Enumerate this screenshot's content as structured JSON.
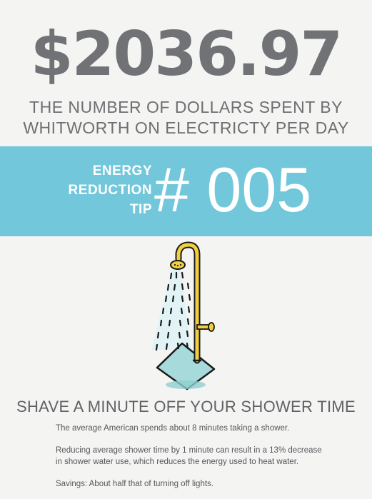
{
  "headline": {
    "amount": "$2036.97",
    "line1": "THE NUMBER OF DOLLARS SPENT BY",
    "line2": "WHITWORTH ON ELECTRICTY PER DAY"
  },
  "band": {
    "label_line1": "ENERGY",
    "label_line2": "REDUCTION",
    "label_line3": "TIP",
    "number": "# 005"
  },
  "illustration": {
    "icon": "shower-icon"
  },
  "tip": {
    "title": "SHAVE A MINUTE OFF YOUR SHOWER TIME",
    "paragraph1": "The average American spends about 8 minutes taking a shower.",
    "paragraph2_line1": "Reducing average shower time by 1 minute can result in a 13% decrease",
    "paragraph2_line2": "in shower water use, which reduces the energy used to heat water.",
    "paragraph3": "Savings: About half that of turning off lights."
  },
  "colors": {
    "background": "#f4f4f3",
    "band": "#72c7db",
    "headline_text": "#707275",
    "pipe": "#f1cf3e",
    "mat": "#a7dada"
  }
}
